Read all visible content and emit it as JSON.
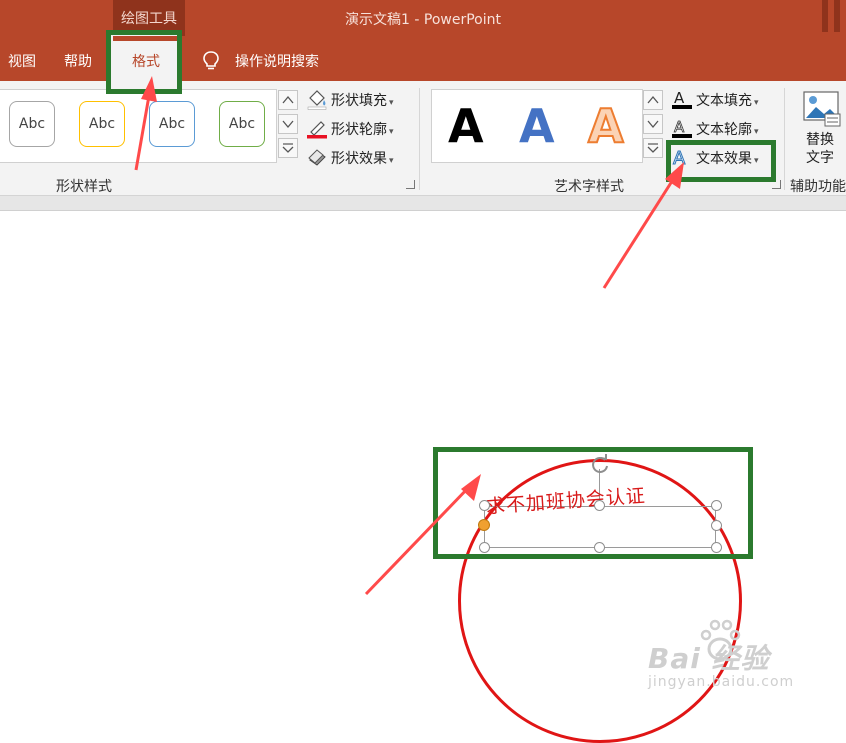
{
  "window": {
    "title": "演示文稿1  -  PowerPoint",
    "context_tab_group": "绘图工具"
  },
  "tabs": [
    {
      "label": "视图"
    },
    {
      "label": "帮助"
    },
    {
      "label": "格式",
      "active": true
    }
  ],
  "tell_me": {
    "label": "操作说明搜索"
  },
  "ribbon": {
    "shape_styles": {
      "group_label": "形状样式",
      "gallery": [
        {
          "label": "Abc",
          "border_color": "#a6a6a6"
        },
        {
          "label": "Abc",
          "border_color": "#ffc000"
        },
        {
          "label": "Abc",
          "border_color": "#5b9bd5"
        },
        {
          "label": "Abc",
          "border_color": "#70ad47"
        }
      ],
      "commands": [
        {
          "label": "形状填充",
          "icon": "paint-bucket-icon"
        },
        {
          "label": "形状轮廓",
          "icon": "pencil-icon"
        },
        {
          "label": "形状效果",
          "icon": "effects-icon"
        }
      ]
    },
    "wordart_styles": {
      "group_label": "艺术字样式",
      "gallery": [
        {
          "label": "A",
          "style": "black"
        },
        {
          "label": "A",
          "style": "blue"
        },
        {
          "label": "A",
          "style": "orange-outline"
        }
      ],
      "commands": [
        {
          "label": "文本填充",
          "icon": "text-fill-icon"
        },
        {
          "label": "文本轮廓",
          "icon": "text-outline-icon"
        },
        {
          "label": "文本效果",
          "icon": "text-effects-icon"
        }
      ]
    },
    "accessibility": {
      "group_label": "辅助功能",
      "alt_text_line1": "替换",
      "alt_text_line2": "文字"
    }
  },
  "slide": {
    "arc_text": "求不加班协会认证"
  },
  "colors": {
    "brand": "#b7472a",
    "highlight": "#2b7a2e",
    "arrow": "#ff4a4a",
    "stamp": "#e01515"
  },
  "watermark": {
    "logo": "Bai 经验",
    "url": "jingyan.baidu.com"
  }
}
